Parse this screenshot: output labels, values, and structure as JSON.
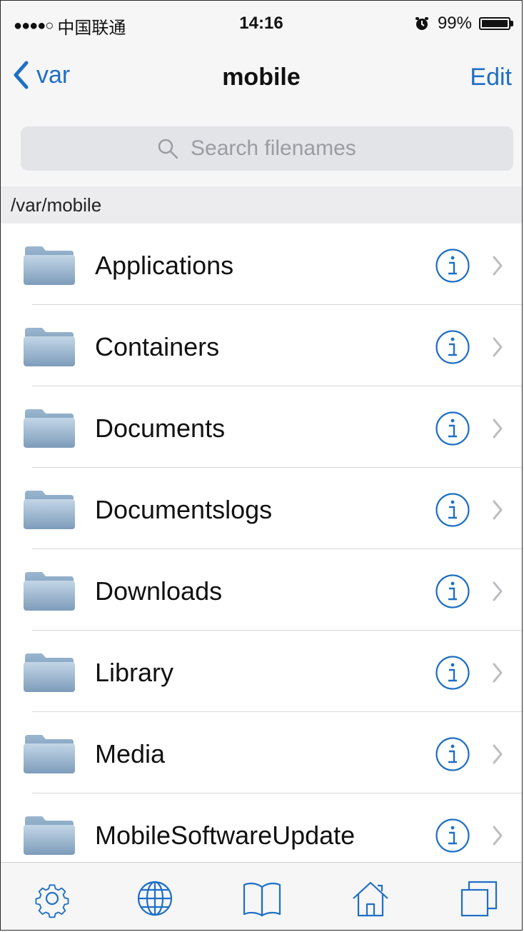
{
  "status_bar": {
    "signal": "●●●●○",
    "carrier": "中国联通",
    "time": "14:16",
    "battery": "99%",
    "battery_level": 0.99
  },
  "nav": {
    "back_label": "var",
    "title": "mobile",
    "edit_label": "Edit"
  },
  "search": {
    "placeholder": "Search filenames"
  },
  "path": "/var/mobile",
  "files": [
    {
      "name": "Applications"
    },
    {
      "name": "Containers"
    },
    {
      "name": "Documents"
    },
    {
      "name": "Documentslogs"
    },
    {
      "name": "Downloads"
    },
    {
      "name": "Library"
    },
    {
      "name": "Media"
    },
    {
      "name": "MobileSoftwareUpdate"
    }
  ],
  "tabs": [
    {
      "icon": "gear-icon"
    },
    {
      "icon": "globe-icon"
    },
    {
      "icon": "book-icon"
    },
    {
      "icon": "home-icon"
    },
    {
      "icon": "copy-icon"
    }
  ],
  "colors": {
    "accent": "#1f6fc5",
    "folder_top": "#b7cde0",
    "folder_bottom": "#7f9fbd"
  }
}
